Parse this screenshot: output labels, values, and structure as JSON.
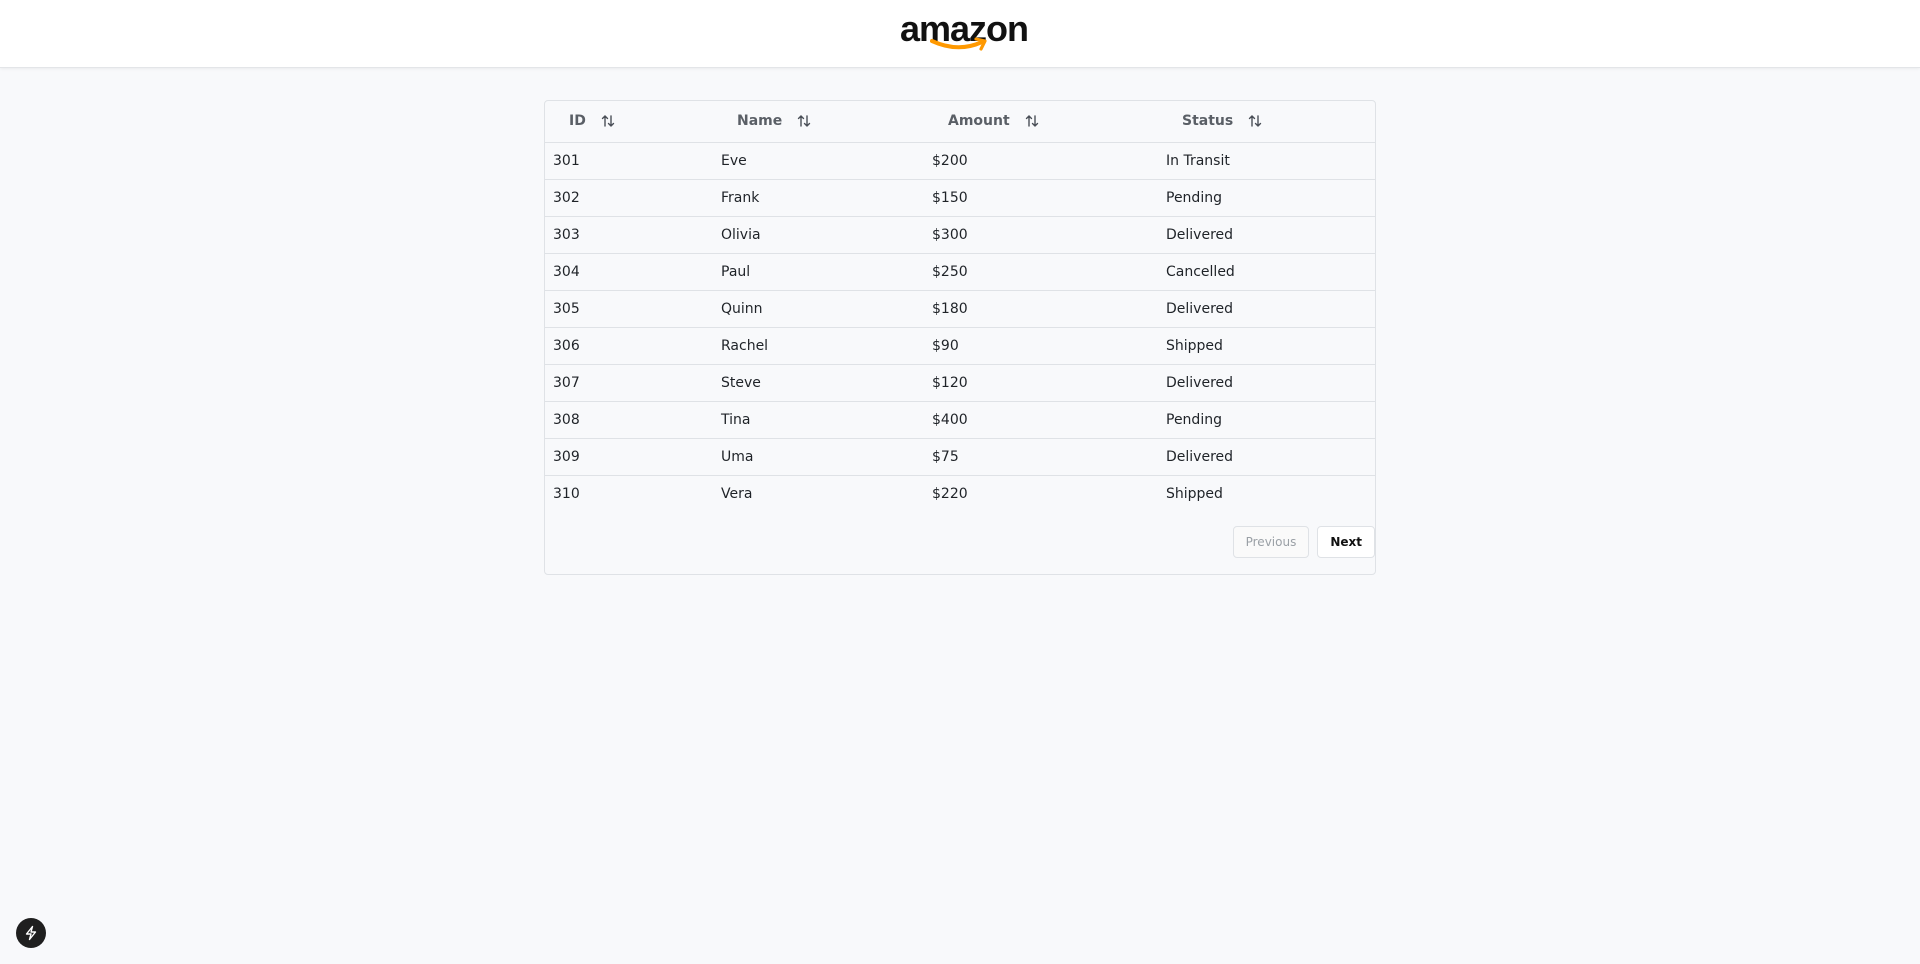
{
  "header": {
    "logo_text": "amazon",
    "logo_icon": "amazon-smile-arrow-icon",
    "accent_color": "#ff9900"
  },
  "table": {
    "columns": [
      {
        "label": "ID",
        "sort_icon": "sort-arrows-icon"
      },
      {
        "label": "Name",
        "sort_icon": "sort-arrows-icon"
      },
      {
        "label": "Amount",
        "sort_icon": "sort-arrows-icon"
      },
      {
        "label": "Status",
        "sort_icon": "sort-arrows-icon"
      }
    ],
    "rows": [
      {
        "id": "301",
        "name": "Eve",
        "amount": "$200",
        "status": "In Transit"
      },
      {
        "id": "302",
        "name": "Frank",
        "amount": "$150",
        "status": "Pending"
      },
      {
        "id": "303",
        "name": "Olivia",
        "amount": "$300",
        "status": "Delivered"
      },
      {
        "id": "304",
        "name": "Paul",
        "amount": "$250",
        "status": "Cancelled"
      },
      {
        "id": "305",
        "name": "Quinn",
        "amount": "$180",
        "status": "Delivered"
      },
      {
        "id": "306",
        "name": "Rachel",
        "amount": "$90",
        "status": "Shipped"
      },
      {
        "id": "307",
        "name": "Steve",
        "amount": "$120",
        "status": "Delivered"
      },
      {
        "id": "308",
        "name": "Tina",
        "amount": "$400",
        "status": "Pending"
      },
      {
        "id": "309",
        "name": "Uma",
        "amount": "$75",
        "status": "Delivered"
      },
      {
        "id": "310",
        "name": "Vera",
        "amount": "$220",
        "status": "Shipped"
      }
    ]
  },
  "pagination": {
    "previous_label": "Previous",
    "next_label": "Next",
    "previous_disabled": true
  },
  "fab": {
    "icon": "lightning-bolt-icon"
  }
}
